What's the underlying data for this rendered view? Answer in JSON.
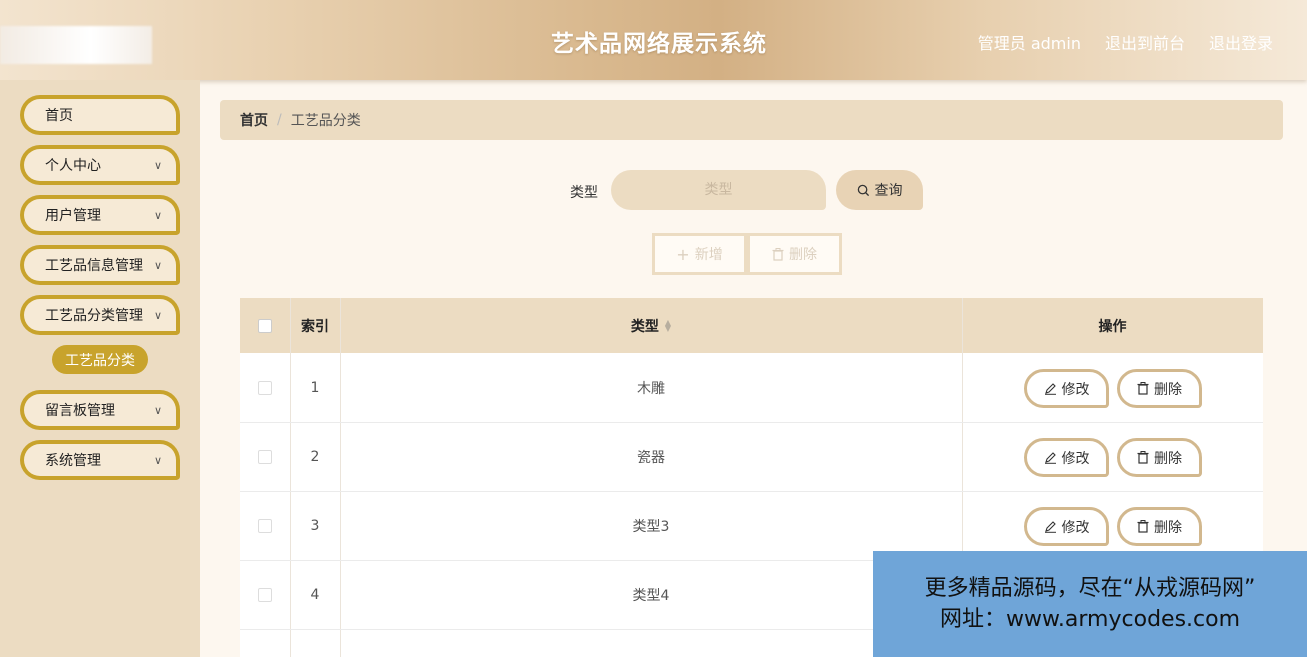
{
  "header": {
    "title": "艺术品网络展示系统",
    "user_label": "管理员 admin",
    "front_link": "退出到前台",
    "logout_link": "退出登录"
  },
  "sidebar": {
    "items": [
      {
        "label": "首页"
      },
      {
        "label": "个人中心"
      },
      {
        "label": "用户管理"
      },
      {
        "label": "工艺品信息管理"
      },
      {
        "label": "工艺品分类管理"
      },
      {
        "label": "留言板管理"
      },
      {
        "label": "系统管理"
      }
    ],
    "active_sub": "工艺品分类"
  },
  "breadcrumb": {
    "home": "首页",
    "separator": "/",
    "current": "工艺品分类"
  },
  "search": {
    "label": "类型",
    "placeholder": "类型",
    "button": "查询"
  },
  "actions": {
    "add": "新增",
    "delete": "删除"
  },
  "table": {
    "headers": {
      "index": "索引",
      "type": "类型",
      "ops": "操作"
    },
    "rows": [
      {
        "index": "1",
        "type": "木雕"
      },
      {
        "index": "2",
        "type": "瓷器"
      },
      {
        "index": "3",
        "type": "类型3"
      },
      {
        "index": "4",
        "type": "类型4"
      }
    ],
    "edit_label": "修改",
    "delete_label": "删除"
  },
  "watermark": {
    "line1": "更多精品源码，尽在“从戎源码网”",
    "line2": "网址：www.armycodes.com"
  },
  "colors": {
    "accent_gold": "#c8a32c",
    "panel_beige": "#ecdcc2",
    "watermark_blue": "#6fa5d8"
  }
}
